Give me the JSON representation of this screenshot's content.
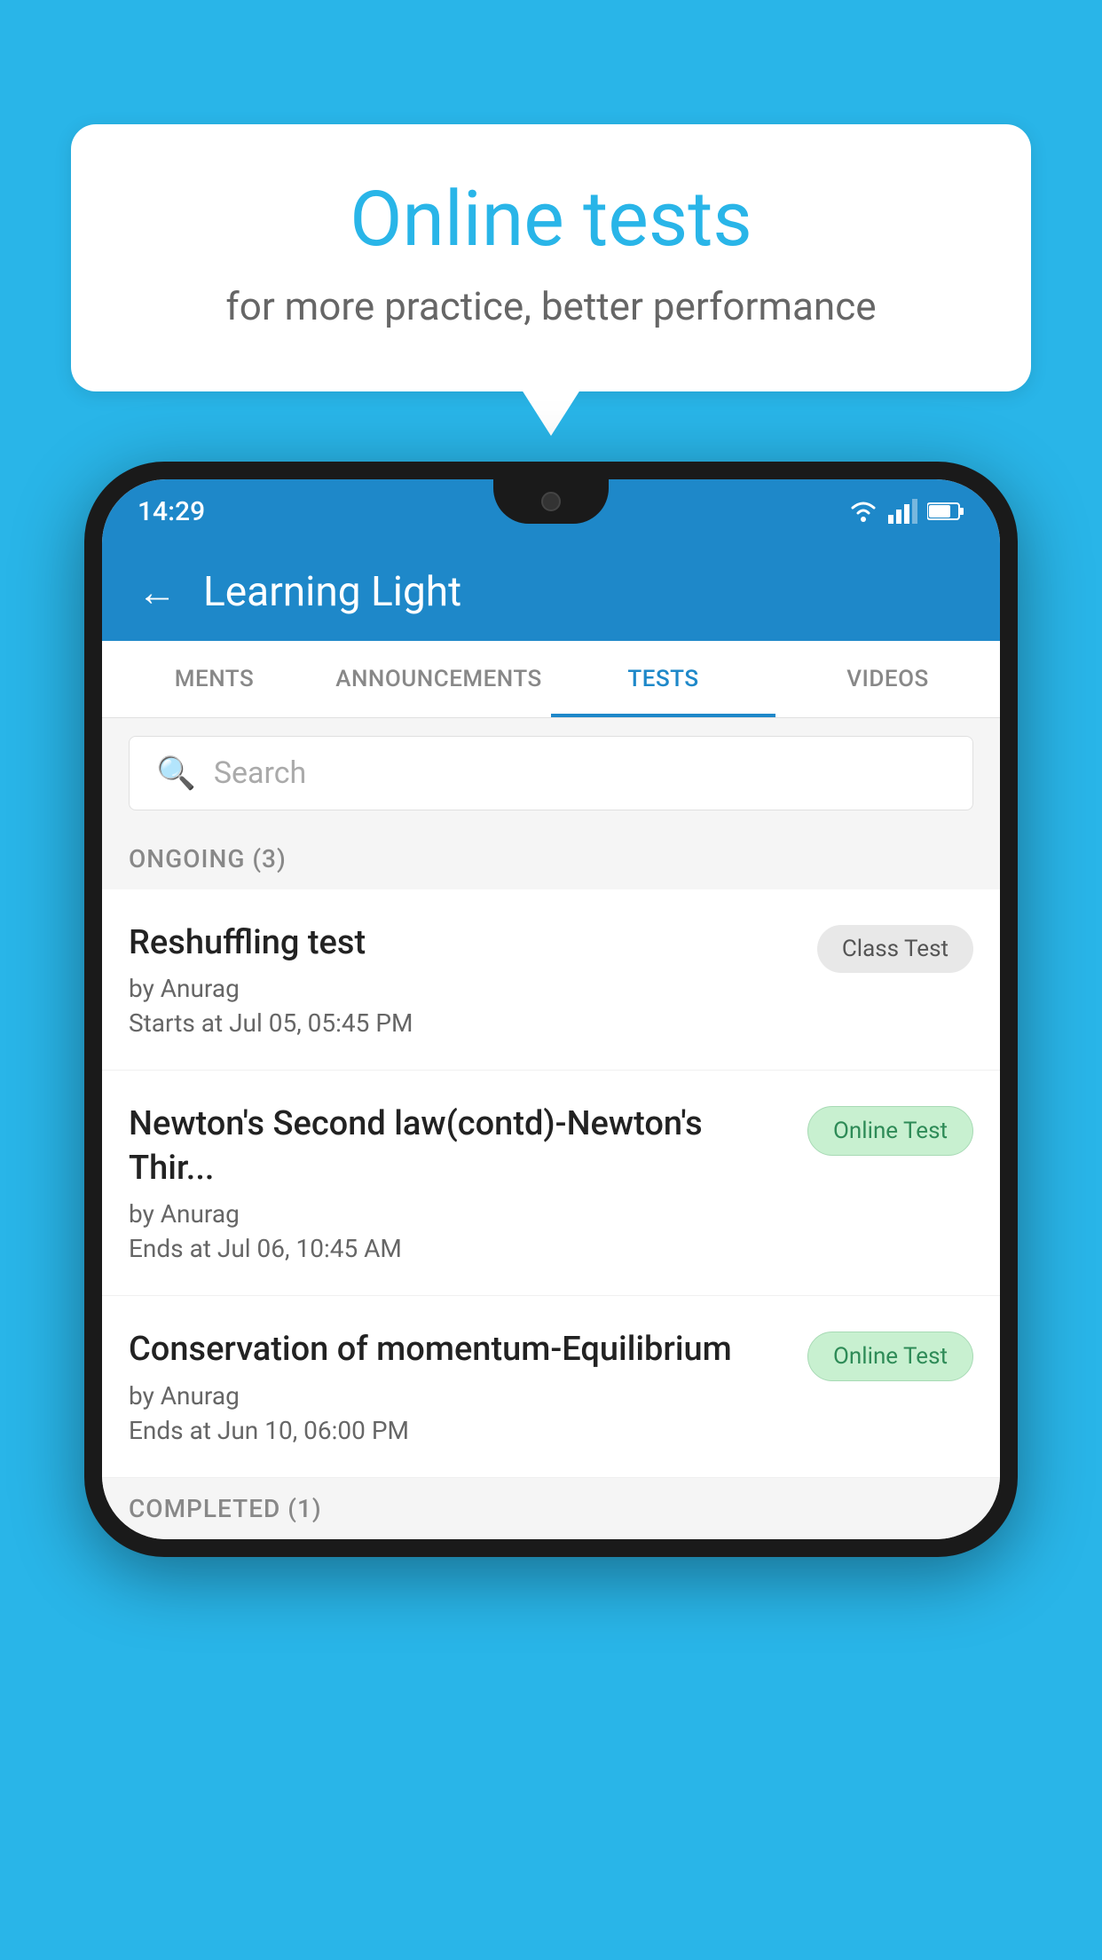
{
  "background_color": "#29b5e8",
  "bubble": {
    "title": "Online tests",
    "subtitle": "for more practice, better performance"
  },
  "phone": {
    "status_bar": {
      "time": "14:29",
      "icons": [
        "wifi",
        "signal",
        "battery"
      ]
    },
    "header": {
      "back_label": "←",
      "title": "Learning Light"
    },
    "tabs": [
      {
        "label": "MENTS",
        "active": false
      },
      {
        "label": "ANNOUNCEMENTS",
        "active": false
      },
      {
        "label": "TESTS",
        "active": true
      },
      {
        "label": "VIDEOS",
        "active": false
      }
    ],
    "search": {
      "placeholder": "Search"
    },
    "ongoing_section": {
      "label": "ONGOING (3)"
    },
    "tests": [
      {
        "name": "Reshuffling test",
        "author": "by Anurag",
        "time_label": "Starts at",
        "time": "Jul 05, 05:45 PM",
        "badge": "Class Test",
        "badge_type": "class"
      },
      {
        "name": "Newton's Second law(contd)-Newton's Thir...",
        "author": "by Anurag",
        "time_label": "Ends at",
        "time": "Jul 06, 10:45 AM",
        "badge": "Online Test",
        "badge_type": "online"
      },
      {
        "name": "Conservation of momentum-Equilibrium",
        "author": "by Anurag",
        "time_label": "Ends at",
        "time": "Jun 10, 06:00 PM",
        "badge": "Online Test",
        "badge_type": "online"
      }
    ],
    "completed_section": {
      "label": "COMPLETED (1)"
    }
  }
}
